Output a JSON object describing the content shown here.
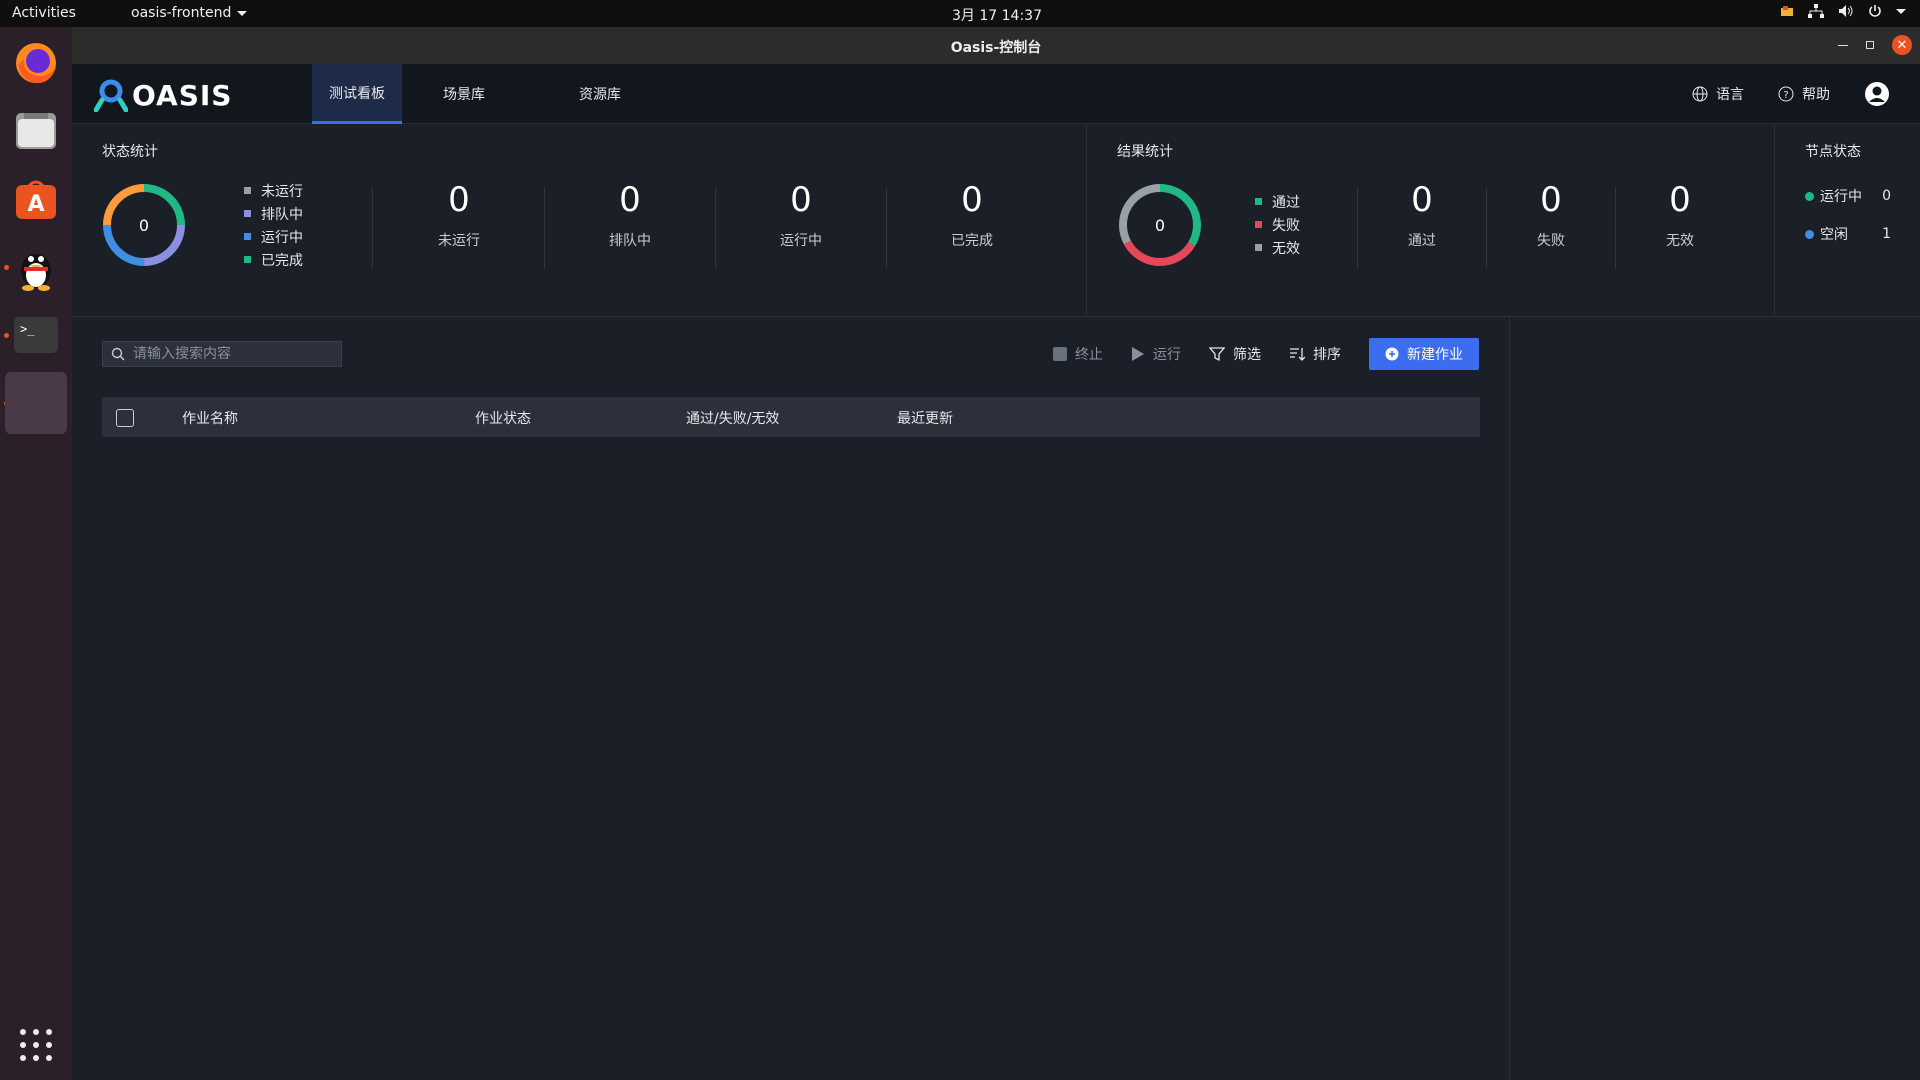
{
  "system_bar": {
    "activities": "Activities",
    "app_menu": "oasis-frontend",
    "clock": "3月 17  14:37"
  },
  "dock": {
    "apps": [
      "firefox-icon",
      "files-icon",
      "app-store-icon",
      "qq-icon",
      "terminal-icon",
      "blank-app-icon"
    ]
  },
  "window": {
    "title": "Oasis-控制台"
  },
  "navbar": {
    "logo": "OASIS",
    "tabs": [
      "测试看板",
      "场景库",
      "资源库"
    ],
    "active_tab": 0,
    "language": "语言",
    "help": "帮助"
  },
  "status_stats": {
    "title": "状态统计",
    "total": "0",
    "legend": [
      {
        "label": "未运行",
        "color": "#9aa0a8"
      },
      {
        "label": "排队中",
        "color": "#8b8fe0"
      },
      {
        "label": "运行中",
        "color": "#3f8fe3"
      },
      {
        "label": "已完成",
        "color": "#20b986"
      }
    ],
    "metrics": [
      {
        "value": "0",
        "label": "未运行"
      },
      {
        "value": "0",
        "label": "排队中"
      },
      {
        "value": "0",
        "label": "运行中"
      },
      {
        "value": "0",
        "label": "已完成"
      }
    ]
  },
  "result_stats": {
    "title": "结果统计",
    "total": "0",
    "legend": [
      {
        "label": "通过",
        "color": "#20b986"
      },
      {
        "label": "失败",
        "color": "#e5485a"
      },
      {
        "label": "无效",
        "color": "#9aa0a8"
      }
    ],
    "metrics": [
      {
        "value": "0",
        "label": "通过"
      },
      {
        "value": "0",
        "label": "失败"
      },
      {
        "value": "0",
        "label": "无效"
      }
    ]
  },
  "node_status": {
    "title": "节点状态",
    "rows": [
      {
        "label": "运行中",
        "value": "0",
        "color": "#20b986"
      },
      {
        "label": "空闲",
        "value": "1",
        "color": "#3f8fe3"
      }
    ]
  },
  "jobs": {
    "search_placeholder": "请输入搜索内容",
    "toolbar": {
      "stop": "终止",
      "run": "运行",
      "filter": "筛选",
      "sort": "排序",
      "new_job": "新建作业"
    },
    "columns": [
      "作业名称",
      "作业状态",
      "通过/失败/无效",
      "最近更新"
    ],
    "rows": []
  },
  "colors": {
    "accent": "#3c6df0"
  }
}
